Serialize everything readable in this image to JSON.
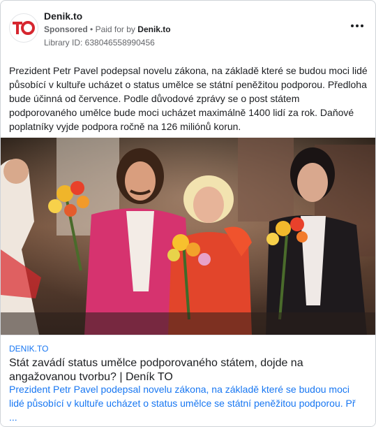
{
  "header": {
    "advertiser": "Denik.to",
    "sponsored_label": "Sponsored",
    "separator": "•",
    "paid_for_by_label": "Paid for by",
    "paid_for_by": "Denik.to",
    "library_id": "Library ID: 638046558990456",
    "logo_text": "TO",
    "logo_color": "#d6262f",
    "more_icon": "more-horizontal-icon"
  },
  "ad_body": {
    "text": "Prezident Petr Pavel podepsal novelu zákona, na základě které se budou moci lidé působící v kultuře ucházet o status umělce se státní peněžitou podporou. Předloha bude účinná od července. Podle důvodové zprávy se o post státem podporovaného umělce bude moci ucházet maximálně 1400 lidí za rok. Daňové poplatníky vyjde podpora ročně na 126 miliónů korun."
  },
  "link_preview": {
    "domain": "DENIK.TO",
    "title": "Stát zavádí status umělce podporovaného státem, dojde na angažovanou tvorbu? | Deník TO",
    "description": "Prezident Petr Pavel podepsal novelu zákona, na základě které se budou moci lidé působící v kultuře ucházet o status umělce se státní peněžitou podporou. Př ..."
  },
  "colors": {
    "link_blue": "#1877f2",
    "text": "#1c1e21",
    "muted": "#65676b"
  }
}
